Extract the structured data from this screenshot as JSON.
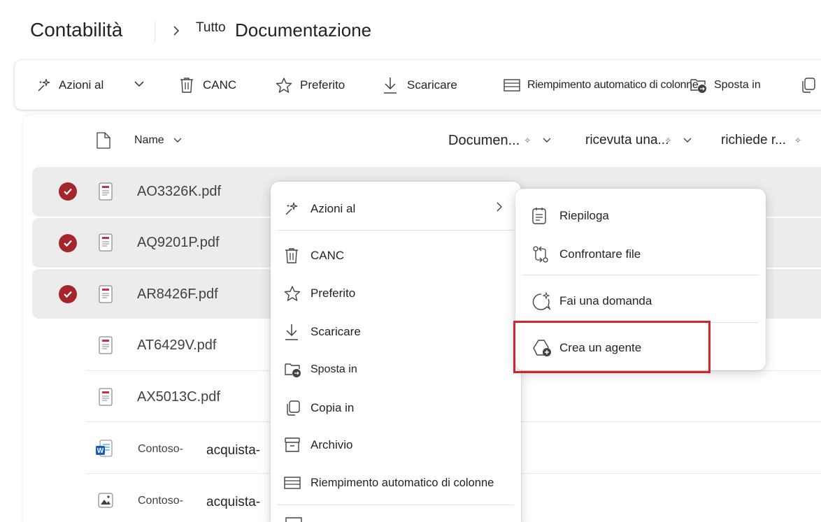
{
  "breadcrumb": {
    "root": "Contabilità",
    "small": "Tutto",
    "current": "Documentazione"
  },
  "toolbar": {
    "ai_actions": "Azioni al",
    "delete": "CANC",
    "favorite": "Preferito",
    "download": "Scaricare",
    "autofill": "Riempimento automatico di colonne",
    "move_to": "Sposta in"
  },
  "columns": {
    "name": "Name",
    "col1": "Documen...",
    "col2": "ricevuta una...",
    "col3": "richiede r..."
  },
  "files": [
    {
      "name": "AO3326K.pdf",
      "selected": true,
      "type": "pdf"
    },
    {
      "name": "AQ9201P.pdf",
      "selected": true,
      "type": "pdf"
    },
    {
      "name": "AR8426F.pdf",
      "selected": true,
      "type": "pdf"
    },
    {
      "name": "AT6429V.pdf",
      "selected": false,
      "type": "pdf"
    },
    {
      "name": "AX5013C.pdf",
      "selected": false,
      "type": "pdf"
    }
  ],
  "docs": [
    {
      "name_a": "Contoso-",
      "name_b": "acquista-",
      "type": "word"
    },
    {
      "name_a": "Contoso-",
      "name_b": "acquista-",
      "type": "image"
    }
  ],
  "context_menu": {
    "ai_actions": "Azioni al",
    "delete": "CANC",
    "favorite": "Preferito",
    "download": "Scaricare",
    "move_to": "Sposta in",
    "copy_to": "Copia in",
    "archive": "Archivio",
    "autofill": "Riempimento automatico di colonne"
  },
  "submenu": {
    "summarize": "Riepiloga",
    "compare": "Confrontare file",
    "ask": "Fai una domanda",
    "create_agent": "Crea un agente"
  },
  "colors": {
    "check": "#a4262c",
    "highlight": "#d1242f",
    "selected_row": "#ececec"
  }
}
